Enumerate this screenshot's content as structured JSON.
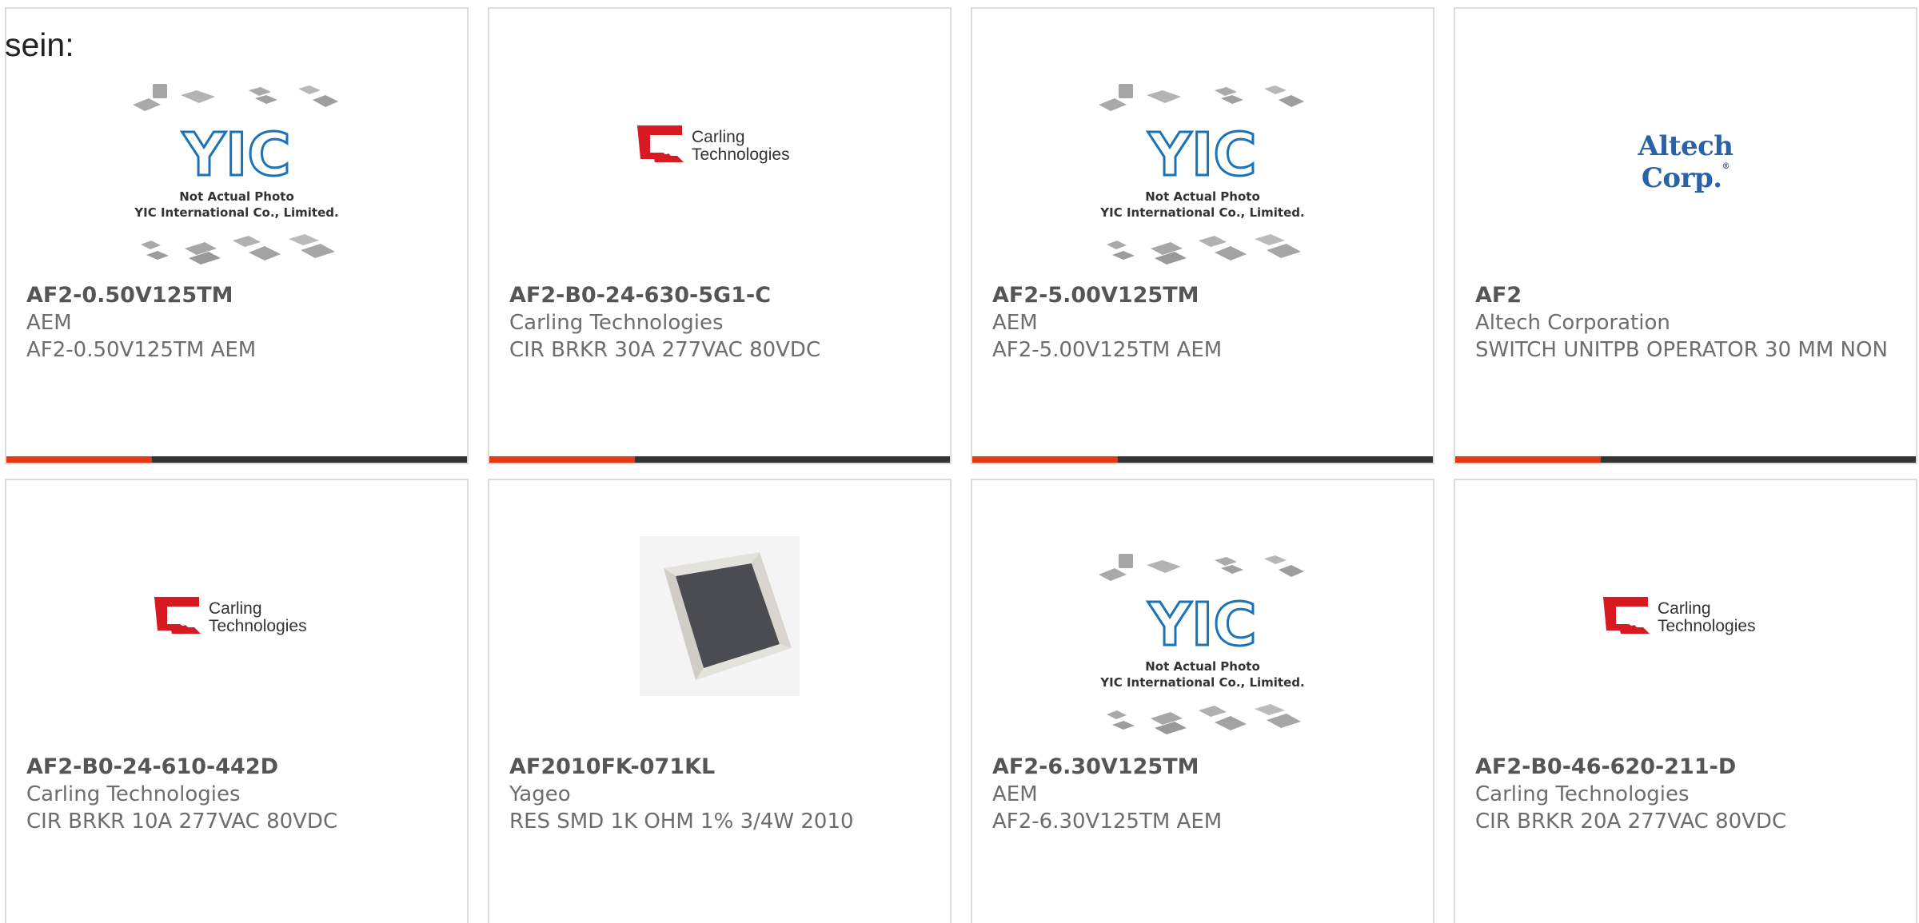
{
  "intro_text": "sein:",
  "colors": {
    "accent": "#e43a12",
    "bar_dark": "#333333",
    "card_border": "#dcdcdc",
    "carling_red": "#d71921",
    "altech_blue": "#2a62a8",
    "yic_blue": "#1a72b8"
  },
  "placeholder": {
    "line1": "Not Actual Photo",
    "line2": "YIC International Co., Limited."
  },
  "logos": {
    "carling_line1": "Carling",
    "carling_line2": "Technologies",
    "altech": "Altech Corp."
  },
  "products": [
    {
      "part_number": "AF2-0.50V125TM",
      "manufacturer": "AEM",
      "description": "AF2-0.50V125TM AEM",
      "image": "yic-placeholder-icon"
    },
    {
      "part_number": "AF2-B0-24-630-5G1-C",
      "manufacturer": "Carling Technologies",
      "description": "CIR BRKR 30A 277VAC 80VDC",
      "image": "carling-logo-icon"
    },
    {
      "part_number": "AF2-5.00V125TM",
      "manufacturer": "AEM",
      "description": "AF2-5.00V125TM AEM",
      "image": "yic-placeholder-icon"
    },
    {
      "part_number": "AF2",
      "manufacturer": "Altech Corporation",
      "description": "SWITCH UNITPB OPERATOR 30 MM NON",
      "image": "altech-logo-icon"
    },
    {
      "part_number": "AF2-B0-24-610-442D",
      "manufacturer": "Carling Technologies",
      "description": "CIR BRKR 10A 277VAC 80VDC",
      "image": "carling-logo-icon"
    },
    {
      "part_number": "AF2010FK-071KL",
      "manufacturer": "Yageo",
      "description": "RES SMD 1K OHM 1% 3/4W 2010",
      "image": "resistor-photo-icon"
    },
    {
      "part_number": "AF2-6.30V125TM",
      "manufacturer": "AEM",
      "description": "AF2-6.30V125TM AEM",
      "image": "yic-placeholder-icon"
    },
    {
      "part_number": "AF2-B0-46-620-211-D",
      "manufacturer": "Carling Technologies",
      "description": "CIR BRKR 20A 277VAC 80VDC",
      "image": "carling-logo-icon"
    }
  ]
}
